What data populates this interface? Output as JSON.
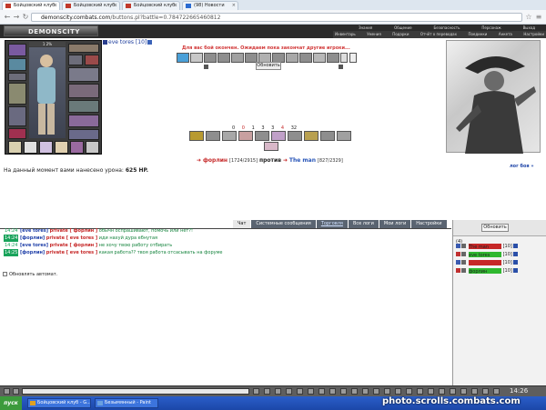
{
  "browser": {
    "tabs": [
      {
        "label": "Бойцовский клуб."
      },
      {
        "label": "Бойцовский клуб."
      },
      {
        "label": "Бойцовский клуб."
      },
      {
        "label": "(98) Новости"
      }
    ],
    "url_host": "demonscity.combats.com",
    "url_path": "/buttons.pl?battle=0.784722665460812"
  },
  "header": {
    "logo": "DEMONSCITY",
    "menu_top": [
      "Знания",
      "Общение",
      "Безопасность",
      "Персонаж",
      "Выход"
    ],
    "menu_bottom": [
      "Инвентарь",
      "Умения",
      "Подарки",
      "Отчёт о переводах",
      "Поединки",
      "Анкета",
      "Настройки"
    ]
  },
  "character": {
    "nick": "eve tores",
    "level": "[10]",
    "hp_label": "1 2%"
  },
  "battle": {
    "status": "Для вас бой окончен. Ожидаем пока закончат другие игроки...",
    "update_label": "Обновить",
    "counts": [
      "0",
      "0",
      "1",
      "3",
      "3",
      "4",
      "32"
    ],
    "fighter1_name": "форлин",
    "fighter1_hp": "[1724/2915]",
    "vs": "против",
    "fighter2_name": "The man",
    "fighter2_hp": "[827/2329]",
    "damage_text": "На данный момент вами нанесено урона:",
    "damage_value": "625 HP.",
    "log_link": "лог боя »"
  },
  "chat": {
    "tabs": [
      "Чат",
      "Системные сообщения",
      "Торговля",
      "Все логи",
      "Мои логи",
      "Настройки"
    ],
    "messages": [
      {
        "time": "14:24",
        "from": "[eve tores]",
        "private": "private [ форлин ]",
        "text": "обычн оспрашивают, помочь или нет?!"
      },
      {
        "time": "14:24",
        "from": "[форлин]",
        "private": "private [ eve tores ]",
        "text": "иди нахуй дура ебнутая"
      },
      {
        "time": "14:24",
        "from": "[eve tores]",
        "private": "private [ форлин ]",
        "text": "не хочу твою работу отбирать"
      },
      {
        "time": "14:25",
        "from": "[форлин]",
        "private": "private [ eve tores ]",
        "text": "какая работа?? твоя работа отсасывать на форуме"
      }
    ]
  },
  "players": {
    "refresh_label": "Обновить",
    "count": "(4)",
    "list": [
      {
        "name": "The man",
        "level": "[10]",
        "bar_color": "#c62828"
      },
      {
        "name": "eve tores",
        "level": "[10]",
        "bar_color": "#2fb82f"
      },
      {
        "name": "",
        "level": "[10]",
        "bar_color": "#c62828"
      },
      {
        "name": "форлин",
        "level": "[10]",
        "bar_color": "#2fb82f"
      }
    ],
    "auto_refresh_label": "Обновлять автомат."
  },
  "toolbar": {
    "clock": "14:26"
  },
  "taskbar": {
    "start_label": "пуск",
    "tasks": [
      "Бойцовский клуб - G...",
      "Безымянный - Paint"
    ]
  },
  "watermark": "photo.scrolls.combats.com"
}
